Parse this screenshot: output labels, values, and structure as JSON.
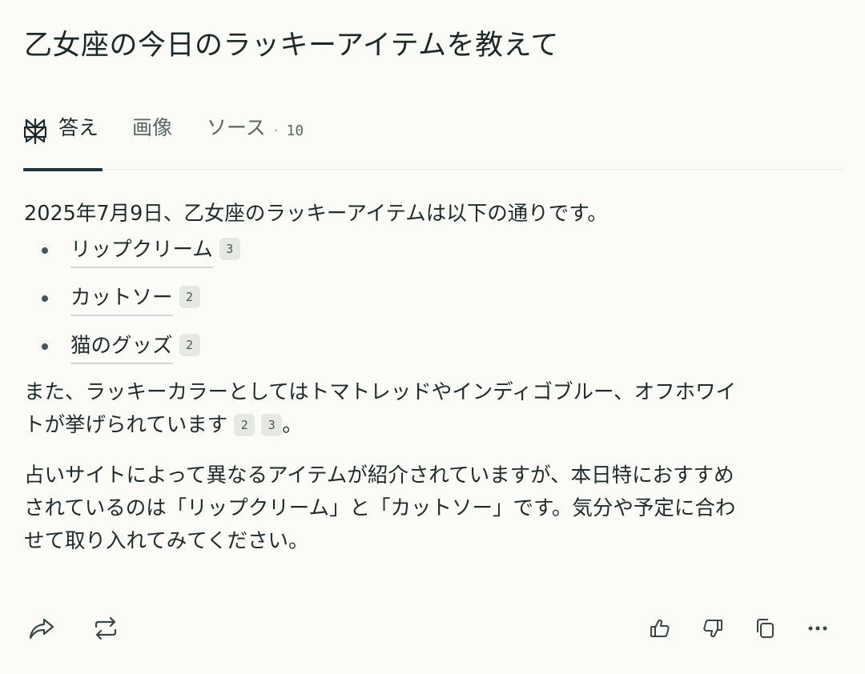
{
  "question": "乙女座の今日のラッキーアイテムを教えて",
  "tabs": {
    "answer": "答え",
    "images": "画像",
    "sources": "ソース",
    "sources_dot": "·",
    "sources_count": "10"
  },
  "answer": {
    "intro": "2025年7月9日、乙女座のラッキーアイテムは以下の通りです。",
    "items": [
      {
        "label": "リップクリーム",
        "cite": "3"
      },
      {
        "label": "カットソー",
        "cite": "2"
      },
      {
        "label": "猫のグッズ",
        "cite": "2"
      }
    ],
    "colors_line1": "また、ラッキーカラーとしてはトマトレッドやインディゴブルー、オフホワイ",
    "colors_line2": "トが挙げられています",
    "colors_cites": [
      "2",
      "3"
    ],
    "colors_end": "。",
    "summary_line1": "占いサイトによって異なるアイテムが紹介されていますが、本日特におすすめ",
    "summary_line2": "されているのは「リップクリーム」と「カットソー」です。気分や予定に合わ",
    "summary_line3": "せて取り入れてみてください。"
  },
  "icons": {
    "answer_tab": "perplexity-logo-icon",
    "share": "share-icon",
    "rewrite": "rewrite-icon",
    "like": "thumbs-up-icon",
    "dislike": "thumbs-down-icon",
    "copy": "copy-icon",
    "more": "more-icon"
  },
  "colors": {
    "background": "#fbfcf8",
    "text": "#1f2a2a",
    "tab_underline": "#1d3438",
    "citation_bg": "#e6e8e4"
  }
}
